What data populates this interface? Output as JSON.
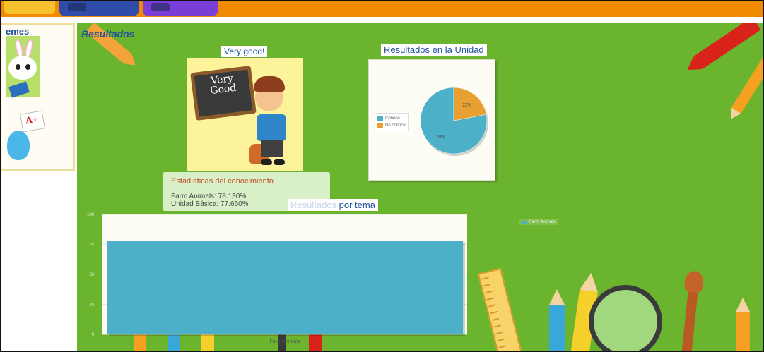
{
  "left_panel": {
    "title_fragment": "emes"
  },
  "main": {
    "section_title": "Resultados",
    "very_good": {
      "title": "Very good!",
      "board_text_1": "Very",
      "board_text_2": "Good"
    },
    "stats": {
      "title": "Estadísticas del conocimiento",
      "line1": "Farm Animals: 78.130%",
      "line2": "Unidad Básica: 77.660%"
    },
    "pie": {
      "title": "Resultados en la Unidad"
    },
    "bar": {
      "title_faded": "Resultados",
      "title_rest": " por tema"
    }
  },
  "chart_data": [
    {
      "type": "pie",
      "title": "Resultados en la Unidad",
      "labels": [
        "Conoce",
        "No conoce"
      ],
      "values": [
        78,
        22
      ],
      "slice_labels": [
        "78%",
        "22%"
      ],
      "colors": [
        "#4bb0c8",
        "#e9a032"
      ],
      "legend_position": "left"
    },
    {
      "type": "bar",
      "title": "Resultados por tema",
      "categories": [
        "Farm Animals"
      ],
      "series": [
        {
          "name": "Farm Animals",
          "values": [
            78.13
          ]
        }
      ],
      "ylim": [
        0,
        100
      ],
      "yticks": [
        "0",
        "25",
        "50",
        "75",
        "100"
      ],
      "color": "#4bb0c8",
      "grid": true,
      "legend_position": "right"
    }
  ]
}
